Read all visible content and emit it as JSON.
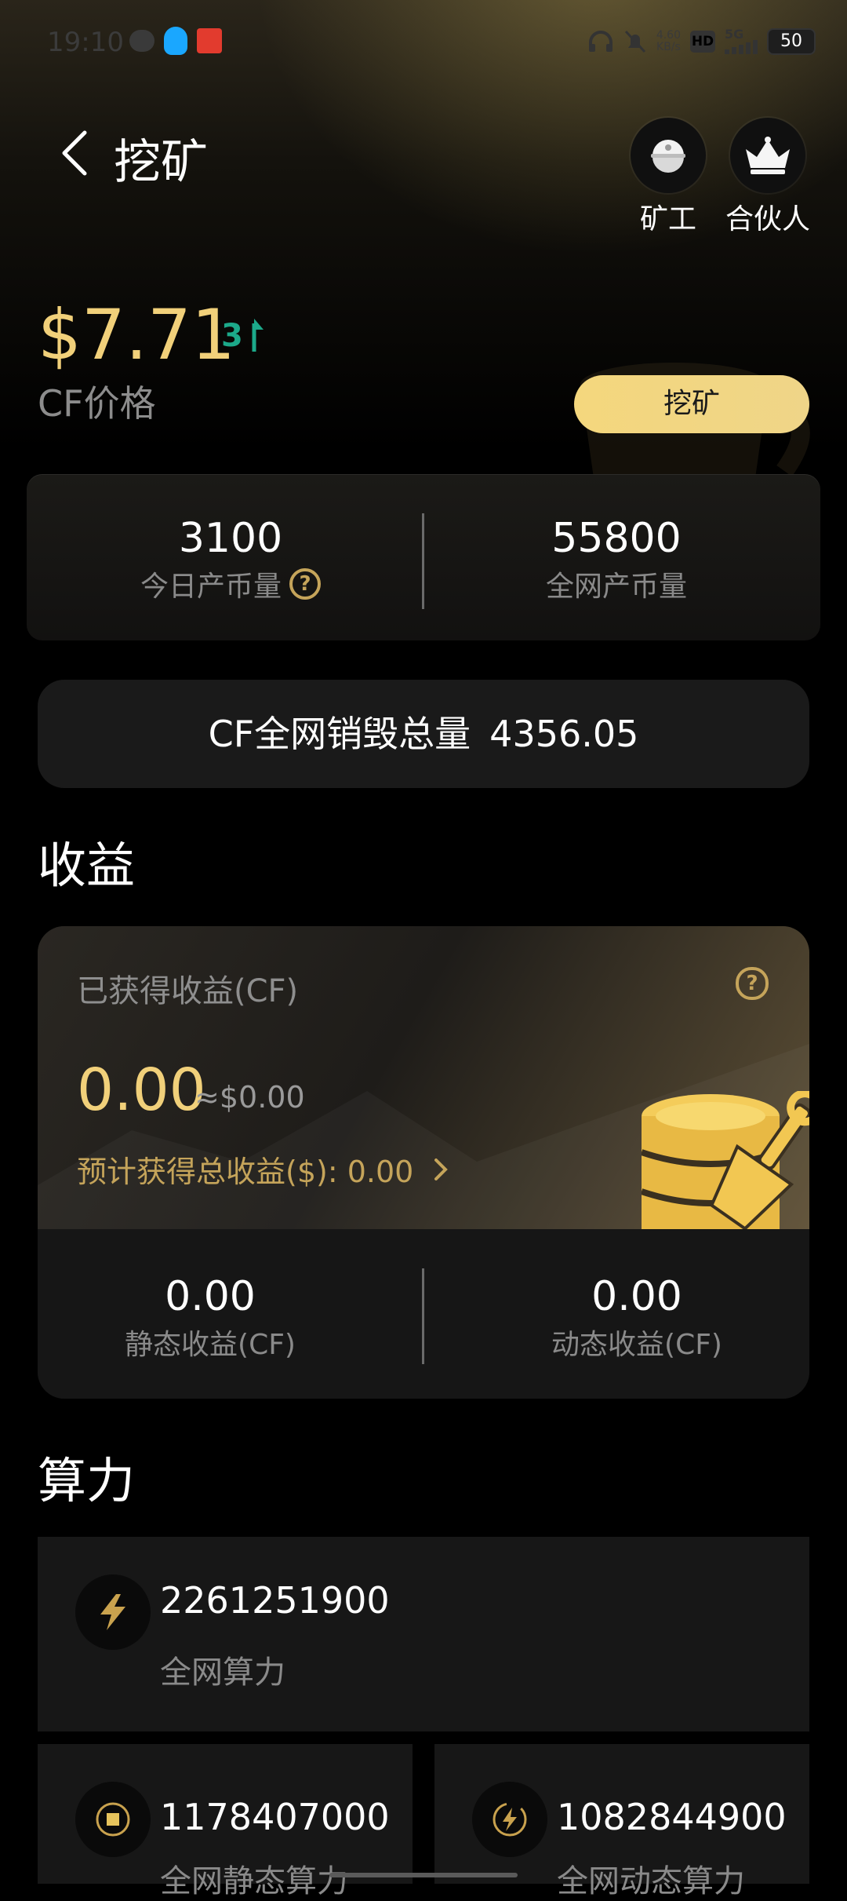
{
  "status_bar": {
    "time": "19:10",
    "net_speed_value": "4.60",
    "net_speed_unit": "KB/s",
    "hd_label": "HD",
    "network": "5G",
    "battery": "50"
  },
  "header": {
    "title": "挖矿",
    "miner_label": "矿工",
    "partner_label": "合伙人"
  },
  "price": {
    "value": "$7.71",
    "change": "3",
    "label": "CF价格",
    "mine_button": "挖矿"
  },
  "stats": {
    "today_value": "3100",
    "today_label": "今日产币量",
    "network_value": "55800",
    "network_label": "全网产币量"
  },
  "burn": {
    "label": "CF全网销毁总量",
    "value": "4356.05"
  },
  "earnings": {
    "section_title": "收益",
    "label": "已获得收益(CF)",
    "value": "0.00",
    "usd": "≈$0.00",
    "estimate": "预计获得总收益($): 0.00",
    "static_value": "0.00",
    "static_label": "静态收益(CF)",
    "dynamic_value": "0.00",
    "dynamic_label": "动态收益(CF)"
  },
  "hash": {
    "section_title": "算力",
    "total_value": "2261251900",
    "total_label": "全网算力",
    "static_value": "1178407000",
    "static_label": "全网静态算力",
    "dynamic_value": "1082844900",
    "dynamic_label": "全网动态算力"
  },
  "colors": {
    "accent_gold": "#f1d07a",
    "up_green": "#1ca98a"
  }
}
